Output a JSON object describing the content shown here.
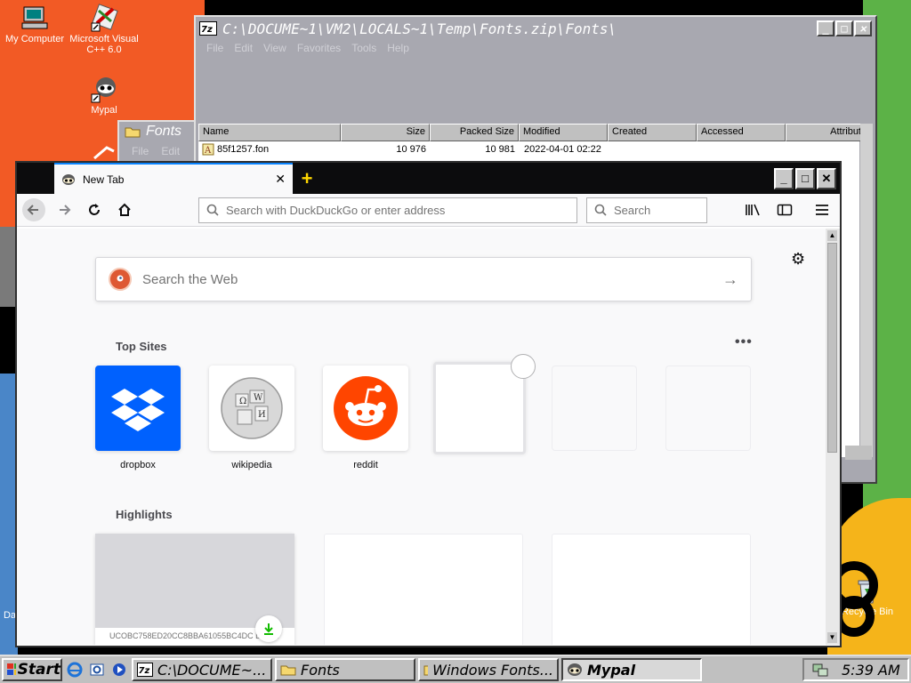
{
  "desktop": {
    "icons": [
      {
        "label": "My Computer"
      },
      {
        "label": "Microsoft Visual C++ 6.0"
      },
      {
        "label": "Mypal"
      },
      {
        "label": "Recycle Bin"
      },
      {
        "label": "Da"
      }
    ]
  },
  "zip_window": {
    "title": "C:\\DOCUME~1\\VM2\\LOCALS~1\\Temp\\Fonts.zip\\Fonts\\",
    "menu": [
      "File",
      "Edit",
      "View",
      "Favorites",
      "Tools",
      "Help"
    ],
    "columns": [
      "Name",
      "Size",
      "Packed Size",
      "Modified",
      "Created",
      "Accessed",
      "Attribut"
    ],
    "rows": [
      {
        "name": "85f1257.fon",
        "size": "10 976",
        "packed": "10 981",
        "modified": "2022-04-01 02:22"
      }
    ]
  },
  "fonts_window": {
    "title": "Fonts",
    "menu": [
      "File",
      "Edit"
    ]
  },
  "browser": {
    "tab_title": "New Tab",
    "url_placeholder": "Search with DuckDuckGo or enter address",
    "search_placeholder": "Search",
    "web_search_placeholder": "Search the Web",
    "top_sites_label": "Top Sites",
    "highlights_label": "Highlights",
    "top_sites": [
      {
        "name": "dropbox",
        "color": "#0061fe"
      },
      {
        "name": "wikipedia",
        "color": "#ffffff"
      },
      {
        "name": "reddit",
        "color": "#ff4500"
      }
    ],
    "highlight_caption": "UCOBC758ED20CC8BBA61055BC4DC DL DR"
  },
  "taskbar": {
    "start_label": "Start",
    "tasks": [
      {
        "label": "C:\\DOCUME~..."
      },
      {
        "label": "Fonts"
      },
      {
        "label": "Windows Fonts..."
      },
      {
        "label": "Mypal"
      }
    ],
    "clock": "5:39 AM"
  }
}
